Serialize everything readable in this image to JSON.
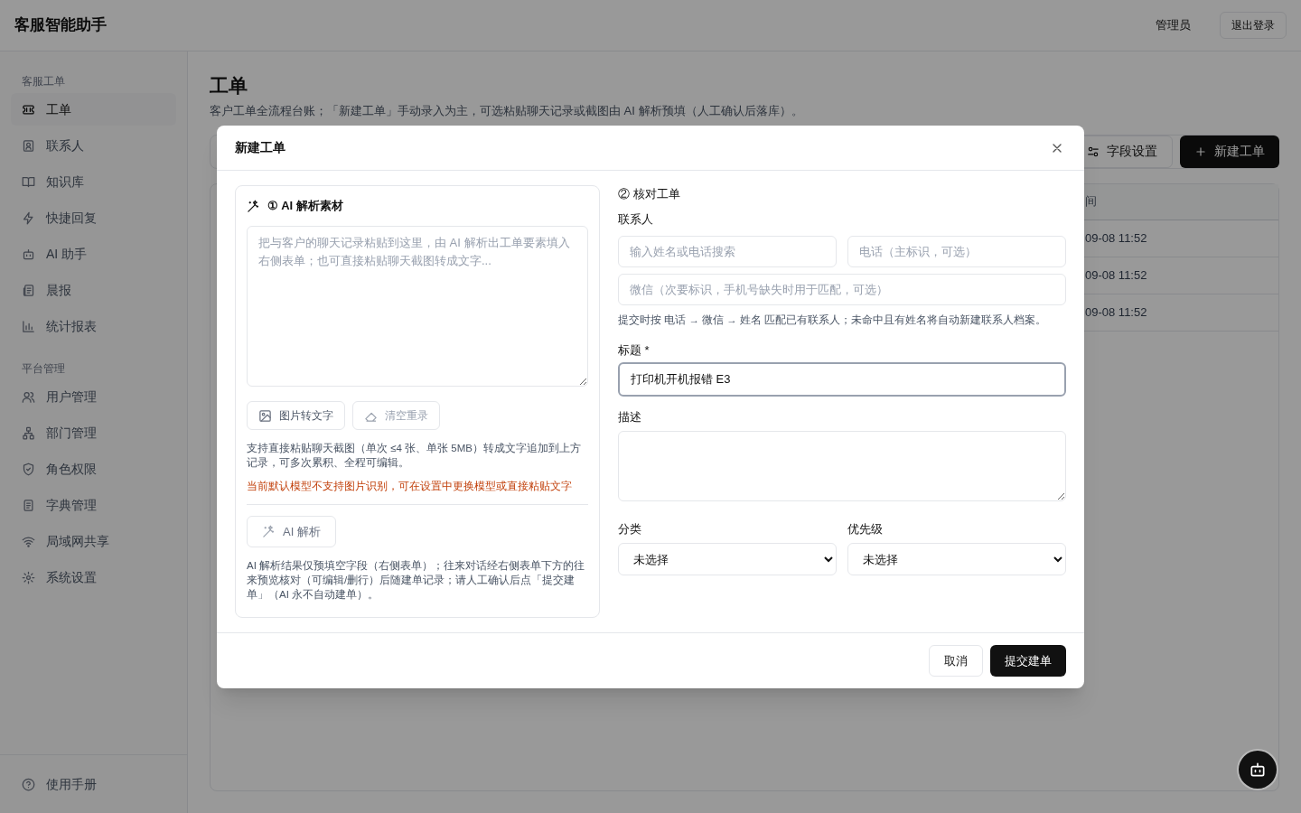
{
  "app": {
    "title": "客服智能助手"
  },
  "header": {
    "user": "管理员",
    "logout": "退出登录"
  },
  "sidebar": {
    "sections": [
      {
        "label": "客服工单",
        "items": [
          {
            "label": "工单",
            "selected": true
          },
          {
            "label": "联系人",
            "selected": false
          },
          {
            "label": "知识库",
            "selected": false
          },
          {
            "label": "快捷回复",
            "selected": false
          },
          {
            "label": "AI 助手",
            "selected": false
          },
          {
            "label": "晨报",
            "selected": false
          },
          {
            "label": "统计报表",
            "selected": false
          }
        ]
      },
      {
        "label": "平台管理",
        "items": [
          {
            "label": "用户管理",
            "selected": false
          },
          {
            "label": "部门管理",
            "selected": false
          },
          {
            "label": "角色权限",
            "selected": false
          },
          {
            "label": "字典管理",
            "selected": false
          },
          {
            "label": "局域网共享",
            "selected": false
          },
          {
            "label": "系统设置",
            "selected": false
          }
        ]
      }
    ],
    "footer_item": {
      "label": "使用手册"
    }
  },
  "page": {
    "title": "工单",
    "subtitle": "客户工单全流程台账；「新建工单」手动录入为主，可选粘贴聊天记录或截图由 AI 解析预填（人工确认后落库）。",
    "toolbar_buttons": [
      {
        "label": "字段设置",
        "kind": "secondary"
      },
      {
        "label": "新建工单",
        "kind": "primary"
      }
    ]
  },
  "table": {
    "columns": [
      "间"
    ],
    "rows": [
      [
        "09-08 11:52"
      ],
      [
        "09-08 11:52"
      ],
      [
        "09-08 11:52"
      ]
    ]
  },
  "dialog": {
    "title": "新建工单",
    "left": {
      "heading": "① AI 解析素材",
      "placeholder": "把与客户的聊天记录粘贴到这里，由 AI 解析出工单要素填入右侧表单；也可直接粘贴聊天截图转成文字...",
      "buttons": [
        {
          "label": "图片转文字",
          "disabled": false
        },
        {
          "label": "清空重录",
          "disabled": true
        }
      ],
      "hint": "支持直接粘贴聊天截图（单次 ≤4 张、单张 5MB）转成文字追加到上方记录，可多次累积、全程可编辑。",
      "warning": "当前默认模型不支持图片识别，可在设置中更换模型或直接粘贴文字",
      "parse_button": "AI 解析",
      "note": "AI 解析结果仅预填空字段（右侧表单）；往来对话经右侧表单下方的往来预览核对（可编辑/删行）后随建单记录；请人工确认后点「提交建单」（AI 永不自动建单）。"
    },
    "right": {
      "heading": "② 核对工单",
      "contact_label": "联系人",
      "contact_search": {
        "placeholder": "输入姓名或电话搜索"
      },
      "phone": {
        "placeholder": "电话（主标识，可选）"
      },
      "wechat": {
        "placeholder": "微信（次要标识，手机号缺失时用于匹配，可选）"
      },
      "contact_hint": "提交时按 电话 → 微信 → 姓名 匹配已有联系人；未命中且有姓名将自动新建联系人档案。",
      "title_label": "标题 *",
      "title_field": {
        "value": "打印机开机报错 E3",
        "focused": true
      },
      "description_label": "描述",
      "category": {
        "label": "分类",
        "value": "未选择"
      },
      "priority": {
        "label": "优先级",
        "value": "未选择"
      }
    },
    "footer_buttons": [
      {
        "label": "取消",
        "kind": "secondary"
      },
      {
        "label": "提交建单",
        "kind": "primary"
      }
    ]
  }
}
